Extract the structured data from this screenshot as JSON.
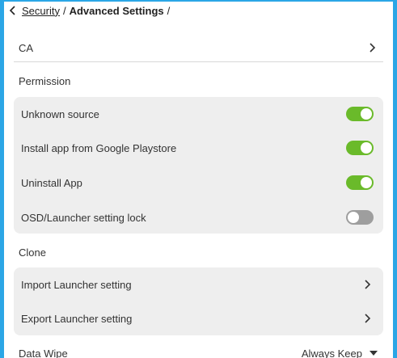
{
  "breadcrumb": {
    "back_icon": "chevron-left-icon",
    "parent": "Security",
    "separator": "/",
    "current": "Advanced Settings",
    "trailing_separator": "/"
  },
  "ca": {
    "label": "CA",
    "icon": "chevron-right-icon"
  },
  "permission": {
    "title": "Permission",
    "items": [
      {
        "label": "Unknown source",
        "enabled": true
      },
      {
        "label": "Install app from Google Playstore",
        "enabled": true
      },
      {
        "label": "Uninstall App",
        "enabled": true
      },
      {
        "label": "OSD/Launcher setting lock",
        "enabled": false
      }
    ]
  },
  "clone": {
    "title": "Clone",
    "items": [
      {
        "label": "Import Launcher setting",
        "icon": "chevron-right-icon"
      },
      {
        "label": "Export Launcher setting",
        "icon": "chevron-right-icon"
      }
    ]
  },
  "data_wipe": {
    "label": "Data Wipe",
    "value": "Always Keep",
    "icon": "caret-down-icon"
  },
  "colors": {
    "frame_border": "#2ba6e6",
    "toggle_on": "#6aba2a",
    "toggle_off": "#9e9e9e",
    "group_bg": "#eeeeee"
  }
}
